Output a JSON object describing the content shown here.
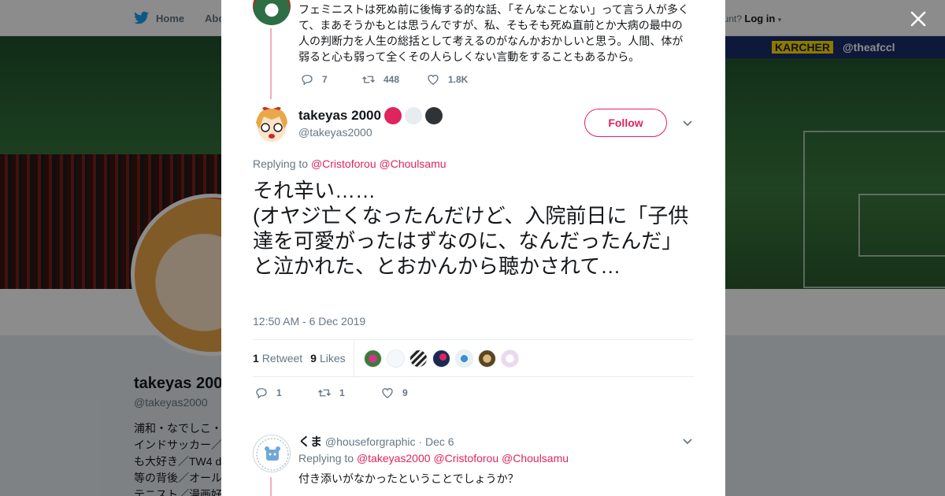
{
  "background": {
    "nav": {
      "home_label": "Home",
      "about_label": "Abo",
      "account_prompt": "ccount?",
      "login_label": "Log in"
    },
    "banner": {
      "ad_left": "KARCHER",
      "ad_right": "@theafccl"
    },
    "profile": {
      "name": "takeyas 200",
      "handle": "@takeyas2000",
      "bio": "浦和・なでしこ・\nインドサッカー／\nも大好き／TW4 d\n等の背後／オール\nテニスト／漫画好"
    }
  },
  "modal": {
    "previous_tweet": {
      "text": "フェミニストは死ぬ前に後悔する的な話、「そんなことない」って言う人が多くて、まあそうかもとは思うんですが、私、そもそも死ぬ直前とか大病の最中の人の判断力を人生の総括として考えるのがなんかおかしいと思う。人間、体が弱ると心も弱って全くその人らしくない言動をすることもあるから。",
      "replies": "7",
      "retweets": "448",
      "likes": "1.8K"
    },
    "tweet": {
      "display_name": "takeyas 2000",
      "name_dot_colors": [
        "#e0245e",
        "#e6ecf0",
        "#2f3336"
      ],
      "handle": "@takeyas2000",
      "follow_label": "Follow",
      "replying_prefix": "Replying to",
      "replying_to": [
        "@Cristoforou",
        "@Choulsamu"
      ],
      "text": "それ辛い……\n(オヤジ亡くなったんだけど、入院前日に「子供達を可愛がったはずなのに、なんだったんだ」と泣かれた、とおかんから聴かされて…",
      "timestamp": "12:50 AM - 6 Dec 2019",
      "retweet_count": "1",
      "retweet_label": "Retweet",
      "like_count": "9",
      "like_label": "Likes",
      "liker_colors": [
        "#8e3a6e",
        "#f5f8fa",
        "#dcdcdc",
        "#1b2a52",
        "#e8f1f8",
        "#8a6b3c",
        "#ead9ee"
      ],
      "actions": {
        "replies": "1",
        "retweets": "1",
        "likes": "9"
      }
    },
    "reply": {
      "display_name": "くま",
      "handle": "@houseforgraphic",
      "separator": "·",
      "date": "Dec 6",
      "replying_prefix": "Replying to",
      "replying_to": [
        "@takeyas2000",
        "@Cristoforou",
        "@Choulsamu"
      ],
      "text": "付き添いがなかったということでしょうか？"
    }
  },
  "colors": {
    "accent": "#e0245e",
    "thread_line": "#f4acb7",
    "muted": "#657786"
  }
}
